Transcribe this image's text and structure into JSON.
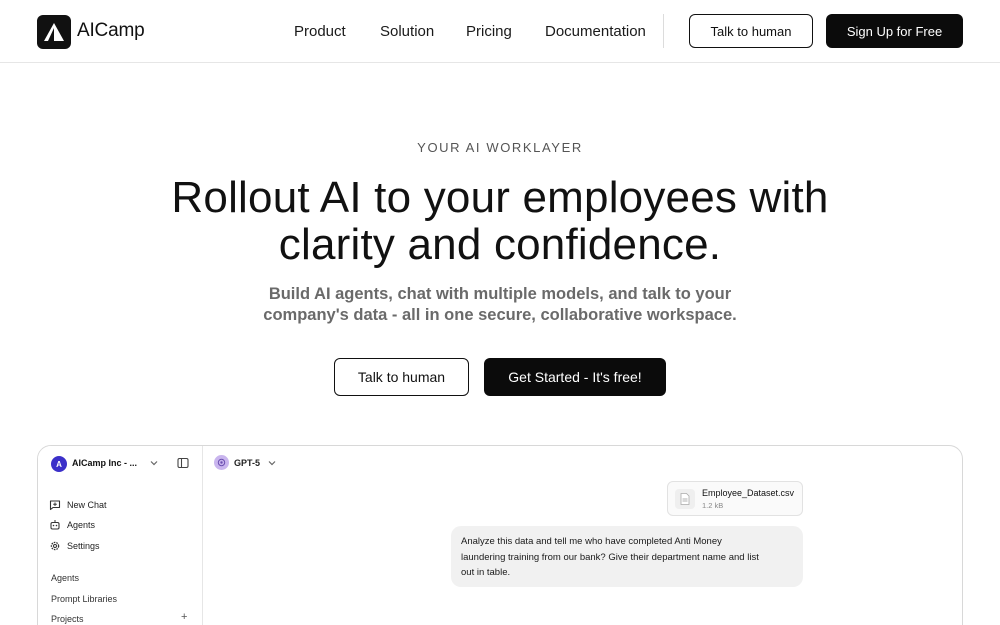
{
  "header": {
    "brand": "AICamp",
    "nav": [
      "Product",
      "Solution",
      "Pricing",
      "Documentation"
    ],
    "talk_label": "Talk to human",
    "signup_label": "Sign Up for Free"
  },
  "hero": {
    "eyebrow": "YOUR AI WORKLAYER",
    "headline_line1": "Rollout AI to your employees with",
    "headline_line2": "clarity and confidence.",
    "subhead_line1": "Build AI agents, chat with multiple models, and talk to your",
    "subhead_line2": "company's data - all in one secure, collaborative workspace.",
    "talk_label": "Talk to human",
    "cta_label": "Get Started - It's free!"
  },
  "preview": {
    "workspace": {
      "avatar_letter": "A",
      "name": "AICamp Inc - ...",
      "avatar_color": "#3b30c9"
    },
    "sidebar": {
      "items": [
        {
          "label": "New Chat",
          "icon": "chat-plus-icon"
        },
        {
          "label": "Agents",
          "icon": "robot-icon"
        },
        {
          "label": "Settings",
          "icon": "gear-icon"
        }
      ],
      "sections": [
        "Agents",
        "Prompt Libraries",
        "Projects"
      ]
    },
    "model": {
      "name": "GPT-5",
      "avatar_color": "#c9b5ee"
    },
    "attachment": {
      "file_name": "Employee_Dataset.csv",
      "file_size": "1.2 kB"
    },
    "message": {
      "line1": "Analyze this data and tell me who have completed Anti Money",
      "line2": "laundering training from our bank? Give their department name and list",
      "line3": "out in table."
    }
  },
  "colors": {
    "primary": "#0b0b0b",
    "text_muted": "#6a6a6a",
    "border": "#e6e6e6"
  }
}
